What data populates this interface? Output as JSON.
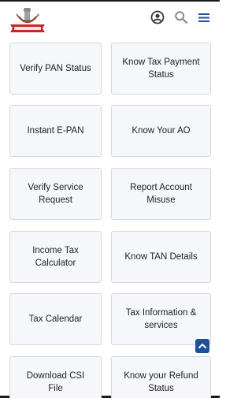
{
  "header": {
    "logo_icon": "income-tax-department-emblem",
    "profile_icon": "user-circle-icon",
    "search_icon": "search-icon",
    "menu_icon": "hamburger-menu-icon"
  },
  "services": [
    {
      "label": "Verify PAN Status"
    },
    {
      "label": "Know Tax Payment Status"
    },
    {
      "label": "Instant E-PAN"
    },
    {
      "label": "Know Your AO"
    },
    {
      "label": "Verify Service Request"
    },
    {
      "label": "Report Account Misuse"
    },
    {
      "label": "Income Tax Calculator"
    },
    {
      "label": "Know TAN Details"
    },
    {
      "label": "Tax Calendar"
    },
    {
      "label": "Tax Information & services"
    },
    {
      "label": "Download CSI File"
    },
    {
      "label": "Know your Refund Status"
    }
  ],
  "scroll_to_top": {
    "icon": "chevron-up-icon"
  },
  "colors": {
    "accent": "#1f4e9b",
    "card_bg": "#f6f7fb",
    "card_border": "#d4d7df",
    "emblem_red": "#c62828",
    "emblem_green": "#2e7d32",
    "icon_gray": "#3a3a3a"
  }
}
